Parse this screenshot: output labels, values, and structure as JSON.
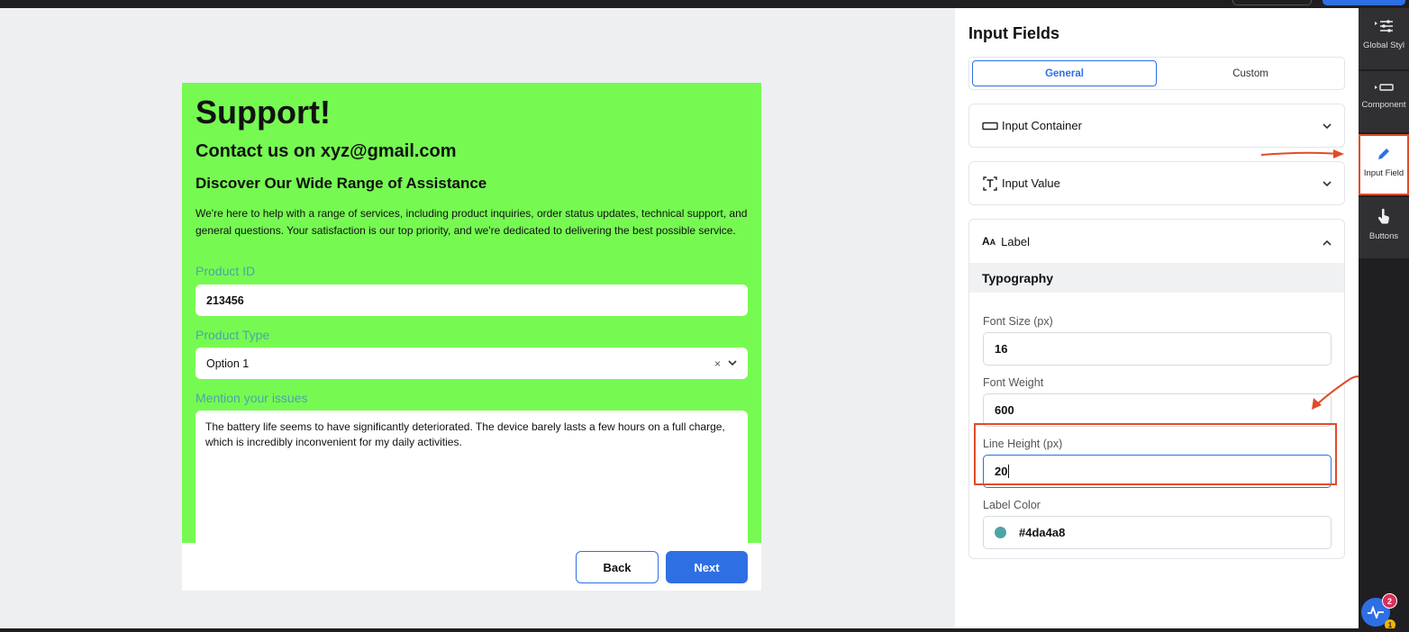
{
  "preview": {
    "title": "Support!",
    "subtitle": "Contact us on xyz@gmail.com",
    "section_heading": "Discover Our Wide Range of Assistance",
    "description": "We're here to help with a range of services, including product inquiries, order status updates, technical support, and general questions. Your satisfaction is our top priority, and we're dedicated to delivering the best possible service.",
    "fields": {
      "product_id_label": "Product ID",
      "product_id_value": "213456",
      "product_type_label": "Product Type",
      "product_type_value": "Option 1",
      "issues_label": "Mention your issues",
      "issues_value": "The battery life seems to have significantly deteriorated. The device barely lasts a few hours on a full charge, which is incredibly inconvenient for my daily activities."
    },
    "buttons": {
      "back": "Back",
      "next": "Next"
    },
    "colors": {
      "card_background": "#76fa52",
      "label_color": "#4da4a8",
      "primary": "#2f6fe4"
    }
  },
  "panel": {
    "title": "Input Fields",
    "tabs": {
      "general": "General",
      "custom": "Custom",
      "active": "General"
    },
    "sections": {
      "input_container": "Input Container",
      "input_value": "Input Value",
      "label": "Label"
    },
    "typography": {
      "heading": "Typography",
      "font_size_label": "Font Size (px)",
      "font_size_value": "16",
      "font_weight_label": "Font Weight",
      "font_weight_value": "600",
      "line_height_label": "Line Height (px)",
      "line_height_value": "20",
      "label_color_label": "Label Color",
      "label_color_value": "#4da4a8"
    }
  },
  "rail": {
    "items": [
      {
        "label": "Global Styl",
        "icon": "sliders-icon"
      },
      {
        "label": "Component",
        "icon": "component-icon"
      },
      {
        "label": "Input Field",
        "icon": "pencil-icon",
        "active": true
      },
      {
        "label": "Buttons",
        "icon": "pointer-hand-icon"
      }
    ],
    "notifications": {
      "primary_count": "2",
      "secondary_count": "1"
    }
  },
  "annotations": {
    "highlight_color": "#e14b2a"
  }
}
